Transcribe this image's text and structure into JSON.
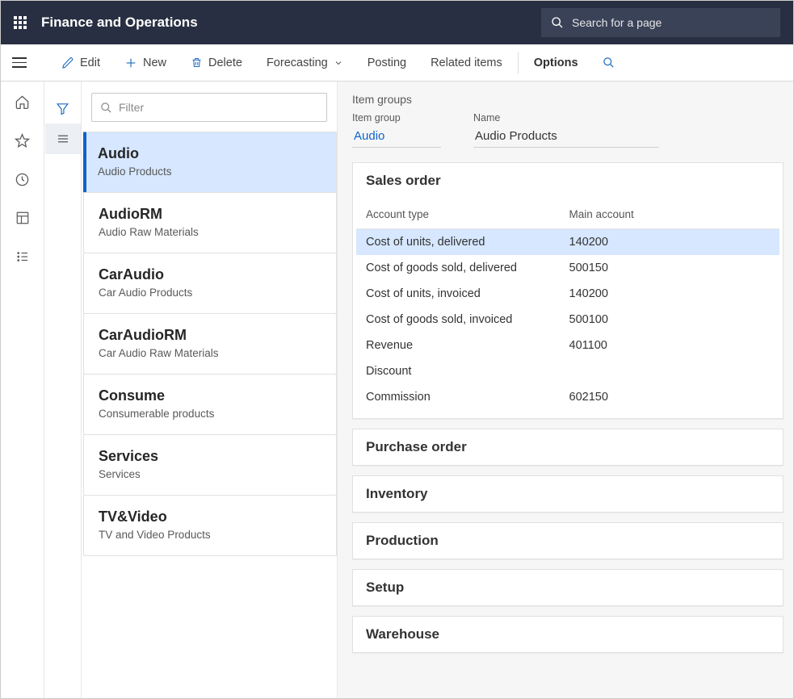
{
  "header": {
    "app_title": "Finance and Operations",
    "search_placeholder": "Search for a page"
  },
  "actions": {
    "edit": "Edit",
    "new": "New",
    "delete": "Delete",
    "forecasting": "Forecasting",
    "posting": "Posting",
    "related": "Related items",
    "options": "Options"
  },
  "filter": {
    "placeholder": "Filter"
  },
  "list": [
    {
      "code": "Audio",
      "name": "Audio Products",
      "selected": true
    },
    {
      "code": "AudioRM",
      "name": "Audio Raw Materials",
      "selected": false
    },
    {
      "code": "CarAudio",
      "name": "Car Audio Products",
      "selected": false
    },
    {
      "code": "CarAudioRM",
      "name": "Car Audio Raw Materials",
      "selected": false
    },
    {
      "code": "Consume",
      "name": "Consumerable products",
      "selected": false
    },
    {
      "code": "Services",
      "name": "Services",
      "selected": false
    },
    {
      "code": "TV&Video",
      "name": "TV and Video Products",
      "selected": false
    }
  ],
  "detail": {
    "page_title": "Item groups",
    "field_labels": {
      "item_group": "Item group",
      "name": "Name"
    },
    "field_values": {
      "item_group": "Audio",
      "name": "Audio Products"
    }
  },
  "sales_order": {
    "title": "Sales order",
    "columns": {
      "account_type": "Account type",
      "main_account": "Main account"
    },
    "rows": [
      {
        "account_type": "Cost of units, delivered",
        "main_account": "140200",
        "selected": true
      },
      {
        "account_type": "Cost of goods sold, delivered",
        "main_account": "500150",
        "selected": false
      },
      {
        "account_type": "Cost of units, invoiced",
        "main_account": "140200",
        "selected": false
      },
      {
        "account_type": "Cost of goods sold, invoiced",
        "main_account": "500100",
        "selected": false
      },
      {
        "account_type": "Revenue",
        "main_account": "401100",
        "selected": false
      },
      {
        "account_type": "Discount",
        "main_account": "",
        "selected": false
      },
      {
        "account_type": "Commission",
        "main_account": "602150",
        "selected": false
      }
    ]
  },
  "fasttabs": {
    "purchase_order": "Purchase order",
    "inventory": "Inventory",
    "production": "Production",
    "setup": "Setup",
    "warehouse": "Warehouse"
  }
}
